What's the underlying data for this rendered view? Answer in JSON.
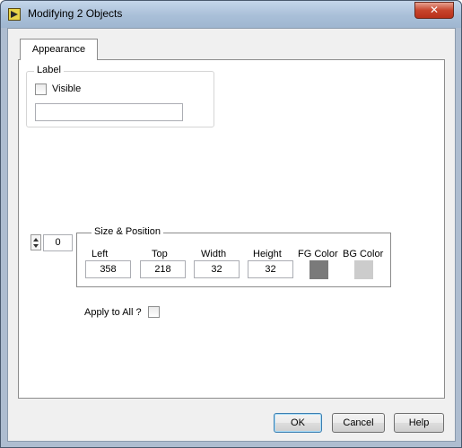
{
  "window": {
    "title": "Modifying 2 Objects",
    "close_glyph": "✕"
  },
  "tabs": [
    {
      "label": "Appearance"
    }
  ],
  "label_group": {
    "title": "Label",
    "visible_label": "Visible",
    "visible_checked": false,
    "text_value": ""
  },
  "order": {
    "value": "0"
  },
  "size_position": {
    "title": "Size & Position",
    "fields": [
      {
        "label": "Left",
        "value": "358"
      },
      {
        "label": "Top",
        "value": "218"
      },
      {
        "label": "Width",
        "value": "32"
      },
      {
        "label": "Height",
        "value": "32"
      }
    ],
    "fg_label": "FG Color",
    "fg_color": "#7a7a7a",
    "bg_label": "BG Color",
    "bg_color": "#cccccc"
  },
  "apply_all": {
    "label": "Apply to All ?",
    "checked": false
  },
  "buttons": {
    "ok": "OK",
    "cancel": "Cancel",
    "help": "Help"
  }
}
